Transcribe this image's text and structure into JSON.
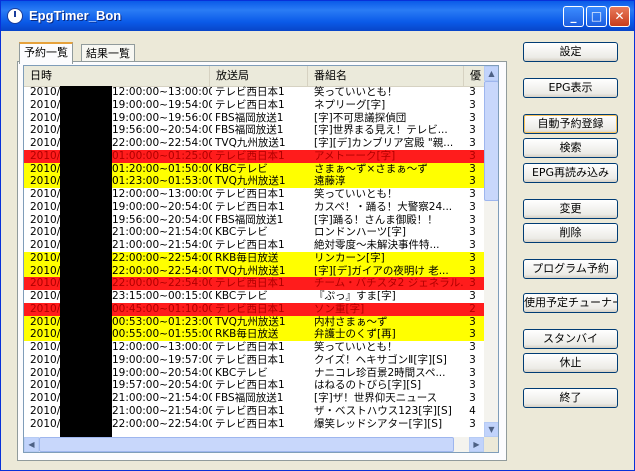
{
  "window": {
    "title": "EpgTimer_Bon"
  },
  "tabs": [
    {
      "label": "予約一覧"
    },
    {
      "label": "結果一覧"
    }
  ],
  "columns": {
    "datetime": "日時",
    "station": "放送局",
    "program": "番組名",
    "priority": "優"
  },
  "rows": [
    {
      "date": "2010/",
      "time": "12:00:00~13:00:00",
      "station": "テレビ西日本1",
      "title": "笑っていいとも！",
      "priority": "3",
      "state": "normal"
    },
    {
      "date": "2010/",
      "time": "19:00:00~19:54:00",
      "station": "テレビ西日本1",
      "title": "ネプリーグ[字]",
      "priority": "3",
      "state": "normal"
    },
    {
      "date": "2010/",
      "time": "19:00:00~19:56:00",
      "station": "FBS福岡放送1",
      "title": "[字]不可思議探偵団",
      "priority": "3",
      "state": "normal"
    },
    {
      "date": "2010/",
      "time": "19:56:00~20:54:00",
      "station": "FBS福岡放送1",
      "title": "[字]世界まる見え！テレビ...",
      "priority": "3",
      "state": "normal"
    },
    {
      "date": "2010/",
      "time": "22:00:00~22:54:00",
      "station": "TVQ九州放送1",
      "title": "[字][デ]カンブリア宮殿 \"親...",
      "priority": "3",
      "state": "normal"
    },
    {
      "date": "2010/",
      "time": "01:00:00~01:25:00",
      "station": "テレビ西日本1",
      "title": "アメトーーク[字]",
      "priority": "3",
      "state": "red"
    },
    {
      "date": "2010/",
      "time": "01:20:00~01:50:00",
      "station": "KBCテレビ",
      "title": "さまぁ～ず×さまぁ～ず",
      "priority": "3",
      "state": "yellow"
    },
    {
      "date": "2010/",
      "time": "01:23:00~01:53:00",
      "station": "TVQ九州放送1",
      "title": "遠藤淳",
      "priority": "3",
      "state": "yellow"
    },
    {
      "date": "2010/",
      "time": "12:00:00~13:00:00",
      "station": "テレビ西日本1",
      "title": "笑っていいとも！",
      "priority": "3",
      "state": "normal"
    },
    {
      "date": "2010/",
      "time": "19:00:00~20:54:00",
      "station": "テレビ西日本1",
      "title": "カスペ！・踊る！大警察24...",
      "priority": "3",
      "state": "normal"
    },
    {
      "date": "2010/",
      "time": "19:56:00~20:54:00",
      "station": "FBS福岡放送1",
      "title": "[字]踊る！さんま御殿！！",
      "priority": "3",
      "state": "normal"
    },
    {
      "date": "2010/",
      "time": "21:00:00~21:54:00",
      "station": "KBCテレビ",
      "title": "ロンドンハーツ[字]",
      "priority": "3",
      "state": "normal"
    },
    {
      "date": "2010/",
      "time": "21:00:00~21:54:00",
      "station": "テレビ西日本1",
      "title": "絶対零度～未解決事件特...",
      "priority": "3",
      "state": "normal"
    },
    {
      "date": "2010/",
      "time": "22:00:00~22:54:00",
      "station": "RKB毎日放送",
      "title": "リンカーン[字]",
      "priority": "3",
      "state": "yellow"
    },
    {
      "date": "2010/",
      "time": "22:00:00~22:54:00",
      "station": "TVQ九州放送1",
      "title": "[字][デ]ガイアの夜明け 老...",
      "priority": "3",
      "state": "yellow"
    },
    {
      "date": "2010/",
      "time": "22:00:00~22:54:00",
      "station": "テレビ西日本1",
      "title": "チーム・バチスタ2 ジェネラル...",
      "priority": "3",
      "state": "red"
    },
    {
      "date": "2010/",
      "time": "23:15:00~00:15:00",
      "station": "KBCテレビ",
      "title": "『ぷっ』すま[字]",
      "priority": "3",
      "state": "normal"
    },
    {
      "date": "2010/",
      "time": "00:45:00~01:10:00",
      "station": "テレビ西日本1",
      "title": "ソン重[字]",
      "priority": "2",
      "state": "red"
    },
    {
      "date": "2010/",
      "time": "00:53:00~01:23:00",
      "station": "TVQ九州放送1",
      "title": "内村さまぁ～ず",
      "priority": "3",
      "state": "yellow"
    },
    {
      "date": "2010/",
      "time": "00:55:00~01:55:00",
      "station": "RKB毎日放送",
      "title": "弁護士のくず[再]",
      "priority": "3",
      "state": "yellow"
    },
    {
      "date": "2010/",
      "time": "12:00:00~13:00:00",
      "station": "テレビ西日本1",
      "title": "笑っていいとも！",
      "priority": "3",
      "state": "normal"
    },
    {
      "date": "2010/",
      "time": "19:00:00~19:57:00",
      "station": "テレビ西日本1",
      "title": "クイズ！ヘキサゴンⅡ[字][S]",
      "priority": "3",
      "state": "normal"
    },
    {
      "date": "2010/",
      "time": "19:00:00~20:54:00",
      "station": "KBCテレビ",
      "title": "ナニコレ珍百景2時間スペ...",
      "priority": "3",
      "state": "normal"
    },
    {
      "date": "2010/",
      "time": "19:57:00~20:54:00",
      "station": "テレビ西日本1",
      "title": "はねるのトびら[字][S]",
      "priority": "3",
      "state": "normal"
    },
    {
      "date": "2010/",
      "time": "21:00:00~21:54:00",
      "station": "FBS福岡放送1",
      "title": "[字]ザ！世界仰天ニュース",
      "priority": "3",
      "state": "normal"
    },
    {
      "date": "2010/",
      "time": "21:00:00~21:54:00",
      "station": "テレビ西日本1",
      "title": "ザ・ベストハウス123[字][S]",
      "priority": "4",
      "state": "normal"
    },
    {
      "date": "2010/",
      "time": "22:00:00~22:54:00",
      "station": "テレビ西日本1",
      "title": "爆笑レッドシアター[字][S]",
      "priority": "3",
      "state": "normal"
    }
  ],
  "buttons": {
    "settings": "設定",
    "epg_view": "EPG表示",
    "auto_reserve": "自動予約登録",
    "search": "検索",
    "epg_reload": "EPG再読み込み",
    "change": "変更",
    "delete": "削除",
    "program_reserve": "プログラム予約",
    "tuner_schedule": "使用予定チューナー",
    "standby": "スタンバイ",
    "hibernate": "休止",
    "exit": "終了"
  },
  "colors": {
    "conflict_row": "#ff1c1c",
    "partial_row": "#ffff00",
    "titlebar": "#0a5ae8"
  }
}
